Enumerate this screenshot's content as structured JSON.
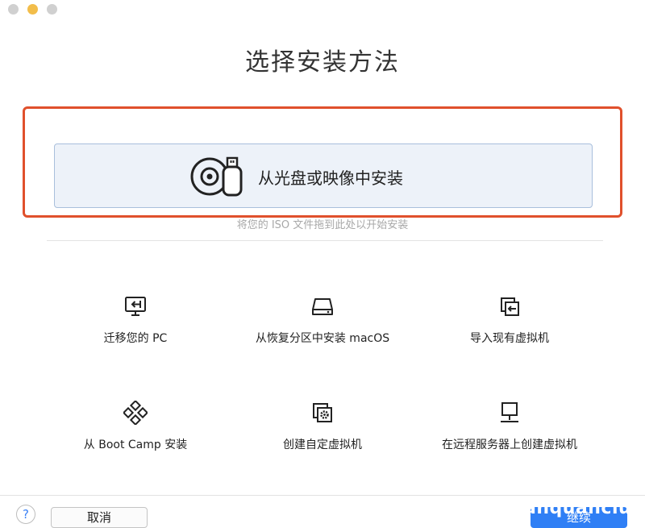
{
  "window": {
    "title": "选择安装方法"
  },
  "primary_option": {
    "label": "从光盘或映像中安装",
    "hint": "将您的 ISO 文件拖到此处以开始安装",
    "icon": "disc-and-usb-icon"
  },
  "options": [
    {
      "label": "迁移您的 PC",
      "icon": "migrate-pc-icon"
    },
    {
      "label": "从恢复分区中安装 macOS",
      "icon": "recovery-drive-icon"
    },
    {
      "label": "导入现有虚拟机",
      "icon": "import-vm-icon"
    },
    {
      "label": "从 Boot Camp 安装",
      "icon": "boot-camp-icon"
    },
    {
      "label": "创建自定虚拟机",
      "icon": "custom-vm-icon"
    },
    {
      "label": "在远程服务器上创建虚拟机",
      "icon": "remote-server-icon"
    }
  ],
  "footer": {
    "help_label": "?",
    "cancel_label": "取消",
    "continue_label": "继续",
    "watermark": "anquanclub.c"
  },
  "colors": {
    "highlight_border": "#e0502c",
    "accent": "#2f7ff5",
    "card_background": "#edf2f9"
  }
}
